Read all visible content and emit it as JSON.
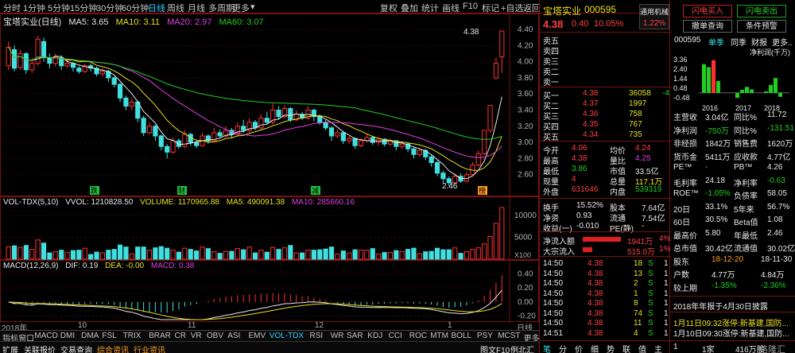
{
  "toolbar": {
    "periods": [
      "分时",
      "1分钟",
      "5分钟",
      "15分钟",
      "30分钟",
      "60分钟",
      "日线",
      "周线",
      "月线",
      "多周期",
      "更多"
    ],
    "active_period": "日线",
    "right_buttons": [
      "复权",
      "叠加",
      "统计",
      "画线",
      "F10",
      "标记",
      "+自选",
      "返回"
    ]
  },
  "price_panel": {
    "title": "宝塔实业(日线)",
    "ma": [
      {
        "label": "MA5: 3.65",
        "color": "#e8e8e8"
      },
      {
        "label": "MA10: 3.11",
        "color": "#e8e020"
      },
      {
        "label": "MA20: 2.97",
        "color": "#e040e0"
      },
      {
        "label": "MA60: 3.07",
        "color": "#20d020"
      }
    ],
    "y_ticks": [
      "4.40",
      "4.20",
      "4.00",
      "3.80",
      "3.60",
      "3.40",
      "3.20",
      "3.00",
      "2.80",
      "2.60"
    ],
    "high_label": "4.38",
    "low_label": "2.46",
    "markers": [
      "跌",
      "财",
      "减",
      "榜"
    ]
  },
  "volume_panel": {
    "title": "VOL-TDX(5,10)",
    "vvol": "VVOL: 1210828.50",
    "volume": "VOLUME: 1170965.88",
    "ma5": "MA5: 490091.38",
    "ma10": "MA10: 285660.16",
    "y_ticks": [
      "10000",
      "5000",
      "X100"
    ]
  },
  "macd_panel": {
    "title": "MACD(12,26,9)",
    "dif": "DIF: 0.19",
    "dea": "DEA: -0.00",
    "macd": "MACD: 0.38",
    "y_ticks": [
      "0.40",
      "0.20",
      "0.00",
      "-0.20"
    ]
  },
  "x_axis": {
    "labels": [
      "2018年",
      "10",
      "11",
      "12",
      "1"
    ],
    "right_label": "日线"
  },
  "indicator_tabs": [
    "指标",
    "窗口",
    "MACD",
    "DMI",
    "DMA",
    "FSL",
    "TRIX",
    "BRAR",
    "CR",
    "VR",
    "OBV",
    "ASI",
    "EMV",
    "VOL-TDX",
    "RSI",
    "WR",
    "SAR",
    "KDJ",
    "CCI",
    "ROC",
    "MTM",
    "BOLL",
    "PSY",
    "MCST",
    "更多"
  ],
  "active_indicator": "VOL-TDX",
  "bottom_tabs": [
    "扩展",
    "关联报价",
    "交易查询",
    "综合资讯",
    "行业资讯"
  ],
  "bottom_right": [
    "图文F10",
    "例北汇"
  ],
  "quote": {
    "name": "宝塔实业",
    "code": "000595",
    "badge": "通用机械",
    "badge_pct": "1.22%",
    "price": "4.38",
    "change": "0.40",
    "change_pct": "10.05%",
    "sell_levels": [
      "卖五",
      "卖四",
      "卖三",
      "卖二",
      "卖一"
    ],
    "buy_levels": [
      {
        "label": "买一",
        "price": "4.38",
        "vol": "36058",
        "diff": "-4"
      },
      {
        "label": "买二",
        "price": "4.37",
        "vol": "1997",
        "diff": ""
      },
      {
        "label": "买三",
        "price": "4.36",
        "vol": "758",
        "diff": ""
      },
      {
        "label": "买四",
        "price": "4.35",
        "vol": "767",
        "diff": ""
      },
      {
        "label": "买五",
        "price": "4.34",
        "vol": "735",
        "diff": ""
      }
    ],
    "stats": [
      {
        "l1": "今开",
        "v1": "4.06",
        "l2": "均价",
        "v2": "4.24"
      },
      {
        "l1": "最高",
        "v1": "4.38",
        "l2": "量比",
        "v2": "4.25"
      },
      {
        "l1": "最低",
        "v1": "3.86",
        "l2": "市值",
        "v2": "33.5亿"
      },
      {
        "l1": "现量",
        "v1": "4",
        "l2": "总量",
        "v2": "117.1万"
      },
      {
        "l1": "外盘",
        "v1": "631646",
        "l2": "内盘",
        "v2": "539319"
      }
    ],
    "stats2": [
      {
        "l1": "换手",
        "v1": "15.52%",
        "l2": "股本",
        "v2": "7.64亿"
      },
      {
        "l1": "净资",
        "v1": "0.93",
        "l2": "流通",
        "v2": "7.54亿"
      },
      {
        "l1": "收益(一)",
        "v1": "-0.010",
        "l2": "PE(静)",
        "v2": "-"
      }
    ],
    "flows": [
      {
        "label": "净流入额",
        "value": "1941万",
        "pct": "4%"
      },
      {
        "label": "大宗流入",
        "value": "515.0万",
        "pct": "1%"
      }
    ],
    "ticks": [
      {
        "time": "14:50",
        "price": "4.38",
        "vol": "18",
        "side": "S",
        "n": "1"
      },
      {
        "time": "14:50",
        "price": "4.38",
        "vol": "13",
        "side": "S",
        "n": "1"
      },
      {
        "time": "14:50",
        "price": "4.38",
        "vol": "2",
        "side": "S",
        "n": "1"
      },
      {
        "time": "14:50",
        "price": "4.38",
        "vol": "1",
        "side": "S",
        "n": "1"
      },
      {
        "time": "14:50",
        "price": "4.38",
        "vol": "8",
        "side": "S",
        "n": "1"
      },
      {
        "time": "14:50",
        "price": "4.38",
        "vol": "74",
        "side": "S",
        "n": "1"
      },
      {
        "time": "14:50",
        "price": "4.38",
        "vol": "11",
        "side": "S",
        "n": "1"
      },
      {
        "time": "14:51",
        "price": "4.38",
        "vol": "4",
        "side": "S",
        "n": "1"
      }
    ],
    "footer": [
      "笔",
      "分",
      "价",
      "细",
      "势",
      "联",
      "值",
      "主"
    ]
  },
  "right": {
    "buttons": [
      "闪电买入",
      "闪电卖出",
      "撤单查询",
      "条件预警"
    ],
    "code": "000595",
    "tabs": [
      "单季",
      "同季",
      "财报",
      "更多.."
    ],
    "chart_unit": "净利润(千万)",
    "chart_y": [
      "3.36",
      "2.40",
      "1.44",
      "0.48",
      "-0.48"
    ],
    "chart_x": [
      "2016",
      "2017",
      "2018"
    ],
    "fin": [
      {
        "l1": "主营收",
        "v1": "3.04亿",
        "l2": "同比%",
        "v2": "11.72"
      },
      {
        "l1": "净利润",
        "v1": "-750万",
        "l2": "同比%",
        "v2": "-131.51"
      },
      {
        "l1": "非经损",
        "v1": "1842万",
        "l2": "销售费",
        "v2": "1620万"
      },
      {
        "l1": "货币金",
        "v1": "5411万",
        "l2": "应收款",
        "v2": "4.77亿"
      },
      {
        "l1": "PE™",
        "v1": "-",
        "l2": "PB™",
        "v2": "4.26"
      },
      {
        "l1": "毛利率",
        "v1": "24.18",
        "l2": "净利率",
        "v2": "-0.63"
      },
      {
        "l1": "ROE™",
        "v1": "-1.05%",
        "l2": "负债率",
        "v2": "58.05"
      },
      {
        "l1": "20日",
        "v1": "33.1%",
        "l2": "5年来",
        "v2": "56.7%"
      },
      {
        "l1": "60日",
        "v1": "30.5%",
        "l2": "Beta值",
        "v2": "1.08"
      },
      {
        "l1": "最高价",
        "v1": "5.80",
        "l2": "年最低",
        "v2": "2.46"
      },
      {
        "l1": "总市值",
        "v1": "30.42亿",
        "l2": "流通值",
        "v2": "30.02亿"
      },
      {
        "l1": "股东",
        "v1": "18-12-20",
        "l2": "",
        "v2": "18-11-30"
      },
      {
        "l1": "户数",
        "v1": "4.77万",
        "l2": "",
        "v2": "4.84万"
      },
      {
        "l1": "较上期",
        "v1": "-1.35%",
        "l2": "",
        "v2": "-2.36%"
      }
    ],
    "news": [
      "2018年年报于4月30日披露",
      "1月11日09:32涨停:新基建,国防...",
      "1月10日09:30涨停:新基建,国防..."
    ],
    "footer_left": "1",
    "footer_mid": "1家",
    "footer_right": "416万股",
    "watermark": "格隆汇"
  },
  "chart_data": {
    "type": "candlestick",
    "title": "宝塔实业(日线)",
    "ylim": [
      2.4,
      4.45
    ],
    "candles": [
      [
        3.95,
        4.18,
        4.25,
        3.9
      ],
      [
        4.15,
        3.92,
        4.2,
        3.88
      ],
      [
        3.93,
        4.1,
        4.15,
        3.9
      ],
      [
        4.1,
        3.9,
        4.12,
        3.85
      ],
      [
        3.9,
        3.98,
        4.05,
        3.86
      ],
      [
        3.98,
        4.28,
        4.32,
        3.95
      ],
      [
        4.25,
        4.05,
        4.3,
        4.0
      ],
      [
        4.05,
        3.98,
        4.1,
        3.92
      ],
      [
        3.98,
        4.06,
        4.1,
        3.94
      ],
      [
        4.05,
        3.95,
        4.08,
        3.9
      ],
      [
        3.95,
        3.98,
        4.02,
        3.92
      ],
      [
        3.98,
        3.93,
        4.0,
        3.88
      ],
      [
        3.92,
        3.88,
        3.95,
        3.85
      ],
      [
        3.88,
        3.95,
        3.98,
        3.86
      ],
      [
        3.95,
        3.92,
        3.98,
        3.88
      ],
      [
        3.92,
        3.85,
        3.94,
        3.82
      ],
      [
        3.85,
        3.88,
        3.92,
        3.82
      ],
      [
        3.88,
        3.8,
        3.9,
        3.75
      ],
      [
        3.8,
        3.72,
        3.82,
        3.68
      ],
      [
        3.72,
        3.55,
        3.74,
        3.5
      ],
      [
        3.55,
        3.45,
        3.58,
        3.4
      ],
      [
        3.45,
        3.5,
        3.55,
        3.4
      ],
      [
        3.5,
        3.3,
        3.52,
        3.25
      ],
      [
        3.3,
        3.12,
        3.33,
        3.08
      ],
      [
        3.12,
        3.2,
        3.25,
        3.1
      ],
      [
        3.2,
        3.08,
        3.22,
        3.02
      ],
      [
        3.08,
        2.95,
        3.1,
        2.9
      ],
      [
        2.95,
        2.88,
        2.98,
        2.8
      ],
      [
        2.88,
        3.02,
        3.06,
        2.86
      ],
      [
        3.02,
        2.95,
        3.05,
        2.92
      ],
      [
        2.95,
        3.1,
        3.15,
        2.93
      ],
      [
        3.1,
        3.0,
        3.12,
        2.96
      ],
      [
        3.0,
        2.96,
        3.02,
        2.93
      ],
      [
        2.96,
        3.08,
        3.12,
        2.95
      ],
      [
        3.08,
        3.02,
        3.1,
        2.98
      ],
      [
        3.02,
        3.12,
        3.18,
        3.0
      ],
      [
        3.12,
        3.08,
        3.16,
        3.05
      ],
      [
        3.08,
        3.15,
        3.2,
        3.06
      ],
      [
        3.15,
        3.1,
        3.18,
        3.05
      ],
      [
        3.1,
        3.2,
        3.25,
        3.08
      ],
      [
        3.2,
        3.15,
        3.28,
        3.12
      ],
      [
        3.15,
        3.25,
        3.3,
        3.12
      ],
      [
        3.25,
        3.18,
        3.28,
        3.15
      ],
      [
        3.18,
        3.3,
        3.35,
        3.16
      ],
      [
        3.3,
        3.25,
        3.38,
        3.22
      ],
      [
        3.25,
        3.4,
        3.48,
        3.22
      ],
      [
        3.4,
        3.32,
        3.45,
        3.28
      ],
      [
        3.32,
        3.42,
        3.46,
        3.3
      ],
      [
        3.42,
        3.28,
        3.44,
        3.25
      ],
      [
        3.28,
        3.35,
        3.4,
        3.26
      ],
      [
        3.35,
        3.3,
        3.38,
        3.28
      ],
      [
        3.3,
        3.4,
        3.45,
        3.28
      ],
      [
        3.4,
        3.32,
        3.42,
        3.26
      ],
      [
        3.32,
        3.25,
        3.35,
        3.22
      ],
      [
        3.25,
        3.18,
        3.28,
        3.15
      ],
      [
        3.18,
        3.08,
        3.2,
        3.02
      ],
      [
        3.08,
        3.12,
        3.16,
        3.05
      ],
      [
        3.12,
        3.02,
        3.14,
        2.98
      ],
      [
        3.02,
        3.05,
        3.08,
        2.98
      ],
      [
        3.05,
        2.96,
        3.06,
        2.92
      ],
      [
        2.96,
        3.02,
        3.05,
        2.94
      ],
      [
        3.02,
        3.06,
        3.1,
        3.0
      ],
      [
        3.06,
        3.0,
        3.08,
        2.97
      ],
      [
        3.0,
        3.04,
        3.06,
        2.96
      ],
      [
        3.04,
        2.98,
        3.05,
        2.95
      ],
      [
        2.98,
        3.02,
        3.04,
        2.96
      ],
      [
        3.02,
        2.95,
        3.03,
        2.9
      ],
      [
        2.95,
        2.98,
        3.0,
        2.92
      ],
      [
        2.98,
        2.92,
        3.0,
        2.88
      ],
      [
        2.92,
        2.85,
        2.94,
        2.8
      ],
      [
        2.85,
        2.9,
        2.93,
        2.82
      ],
      [
        2.9,
        2.82,
        2.92,
        2.78
      ],
      [
        2.82,
        2.75,
        2.85,
        2.7
      ],
      [
        2.75,
        2.62,
        2.78,
        2.58
      ],
      [
        2.62,
        2.55,
        2.65,
        2.5
      ],
      [
        2.55,
        2.5,
        2.58,
        2.46
      ],
      [
        2.5,
        2.58,
        2.62,
        2.48
      ],
      [
        2.58,
        2.52,
        2.62,
        2.5
      ],
      [
        2.52,
        2.6,
        2.64,
        2.5
      ],
      [
        2.6,
        2.72,
        2.76,
        2.58
      ],
      [
        2.72,
        2.86,
        2.9,
        2.7
      ],
      [
        2.86,
        3.15,
        3.15,
        2.84
      ],
      [
        3.15,
        3.46,
        3.46,
        3.12
      ],
      [
        3.8,
        3.98,
        4.05,
        3.78
      ],
      [
        4.06,
        4.38,
        4.38,
        3.86
      ]
    ],
    "volume_max": 12000,
    "macd_range": [
      -0.25,
      0.45
    ]
  }
}
